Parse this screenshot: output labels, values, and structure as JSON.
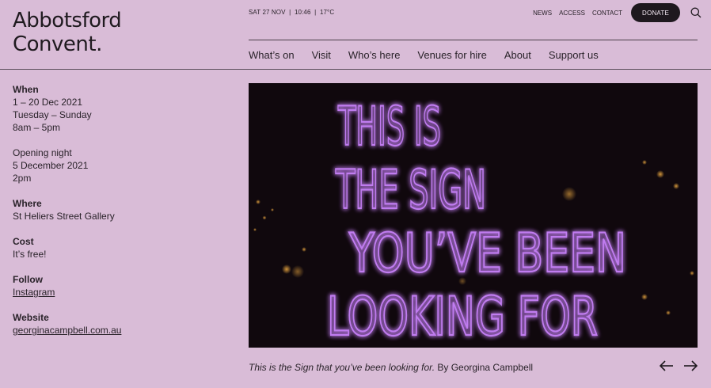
{
  "brand": {
    "line1": "Abbotsford",
    "line2": "Convent."
  },
  "meta": {
    "date_time_weather": "SAT 27 NOV  |  10:46  |  17°C"
  },
  "util_nav": {
    "news": "NEWS",
    "access": "ACCESS",
    "contact": "CONTACT",
    "donate": "DONATE",
    "search_icon": "search-icon"
  },
  "main_nav": [
    "What’s on",
    "Visit",
    "Who’s here",
    "Venues for hire",
    "About",
    "Support us"
  ],
  "details": {
    "when": {
      "heading": "When",
      "lines": [
        "1 – 20 Dec 2021",
        "Tuesday – Sunday",
        "8am – 5pm"
      ]
    },
    "opening": {
      "lines": [
        "Opening night",
        "5 December 2021",
        "2pm"
      ]
    },
    "where": {
      "heading": "Where",
      "value": "St Heliers Street Gallery"
    },
    "cost": {
      "heading": "Cost",
      "value": "It’s free!"
    },
    "follow": {
      "heading": "Follow",
      "link": "Instagram"
    },
    "website": {
      "heading": "Website",
      "link": "georginacampbell.com.au"
    }
  },
  "hero": {
    "neon_lines": [
      "THIS IS",
      "THE SIGN",
      "YOU’VE BEEN",
      "LOOKING FOR"
    ],
    "neon_color": "#c07cf0"
  },
  "caption": {
    "title": "This is the Sign that you’ve been looking for.",
    "credit": " By Georgina Campbell"
  },
  "carousel": {
    "prev_icon": "arrow-left-icon",
    "next_icon": "arrow-right-icon"
  },
  "colors": {
    "background": "#d9bcd7",
    "text": "#1f1a1f",
    "donate_bg": "#1e181e"
  }
}
